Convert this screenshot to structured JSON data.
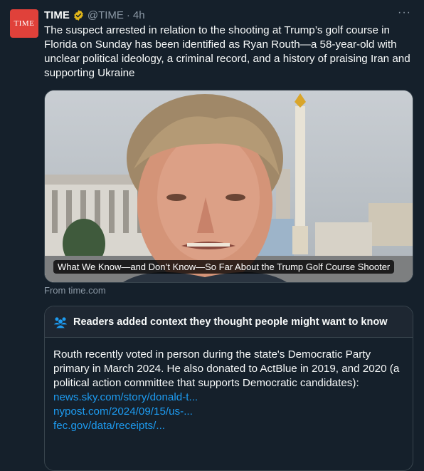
{
  "tweet": {
    "avatar_text": "TIME",
    "display_name": "TIME",
    "handle": "@TIME",
    "separator": "·",
    "time": "4h",
    "more_label": "···",
    "text": "The suspect arrested in relation to the shooting at Trump’s golf course in Florida on Sunday has been identified as Ryan Routh—a 58-year-old with unclear political ideology, a criminal record, and a history of praising Iran and supporting Ukraine"
  },
  "card": {
    "caption": "What We Know—and Don’t Know—So Far About the Trump Golf Course Shooter",
    "source": "From time.com"
  },
  "community_note": {
    "header": "Readers added context they thought people might want to know",
    "body": "Routh recently voted in person during the state's Democratic Party primary in March 2024. He also donated to ActBlue in 2019, and 2020 (a political action committee that supports Democratic candidates):",
    "links": [
      "news.sky.com/story/donald-t...",
      "nypost.com/2024/09/15/us-...",
      "fec.gov/data/receipts/..."
    ]
  },
  "colors": {
    "background": "#15202b",
    "text": "#f7f9f9",
    "muted": "#8b98a5",
    "link": "#1d9bf0",
    "verified": "#e2b719",
    "avatar": "#e0413a",
    "note_accent": "#1d9bf0"
  },
  "icons": {
    "verified": "verified-badge-icon",
    "more": "more-options-icon",
    "note": "people-icon"
  }
}
